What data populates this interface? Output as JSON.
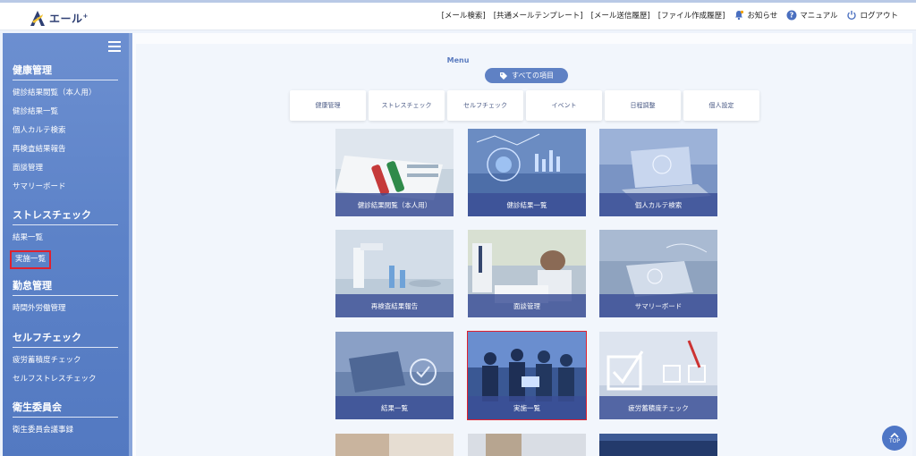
{
  "header": {
    "logo_text": "エール",
    "logo_sup": "+",
    "links": [
      "[メール検索]",
      "[共通メールテンプレート]",
      "[メール送信履歴]",
      "[ファイル作成履歴]"
    ],
    "notice": "お知らせ",
    "manual": "マニュアル",
    "logout": "ログアウト"
  },
  "sidebar": {
    "sections": [
      {
        "title": "健康管理",
        "items": [
          "健診結果閲覧（本人用）",
          "健診結果一覧",
          "個人カルテ検索",
          "再検査結果報告",
          "面談管理",
          "サマリーボード"
        ]
      },
      {
        "title": "ストレスチェック",
        "items": [
          "結果一覧",
          "実施一覧"
        ]
      },
      {
        "title": "勤怠管理",
        "items": [
          "時間外労働管理"
        ]
      },
      {
        "title": "セルフチェック",
        "items": [
          "疲労蓄積度チェック",
          "セルフストレスチェック"
        ]
      },
      {
        "title": "衛生委員会",
        "items": [
          "衛生委員会議事録"
        ]
      }
    ]
  },
  "main": {
    "menu_title": "Menu",
    "all_items": "すべての項目",
    "tabs": [
      "健康管理",
      "ストレスチェック",
      "セルフチェック",
      "イベント",
      "日程調整",
      "個人設定"
    ],
    "cards": [
      "健診結果閲覧（本人用）",
      "健診結果一覧",
      "個人カルテ検索",
      "再検査結果報告",
      "面談管理",
      "サマリーボード",
      "結果一覧",
      "実施一覧",
      "疲労蓄積度チェック"
    ]
  },
  "top_button": "TOP",
  "colors": {
    "accent": "#5f81c4",
    "highlight": "#e0212e",
    "sidebar": "#5c82c8"
  }
}
